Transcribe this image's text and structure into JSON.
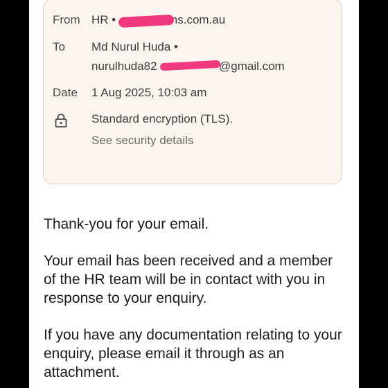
{
  "header": {
    "from_label": "From",
    "from_value": "HR • ",
    "from_domain": "ins.com.au",
    "to_label": "To",
    "to_name": "Md Nurul Huda •",
    "to_email_prefix": "nurulhuda82",
    "to_email_suffix": "@gmail.com",
    "date_label": "Date",
    "date_value": "1 Aug 2025, 10:03 am",
    "encryption_text": "Standard encryption (TLS).",
    "security_link": "See security details",
    "lock_icon": "lock-icon",
    "redaction_color": "#f02e78"
  },
  "message": {
    "para1": "Thank-you for your email.",
    "para2": "Your email has been received and a member of the HR team will be in contact with you in response to your enquiry.",
    "para3": "If you have any documentation relating to your enquiry, please email it through as an attachment."
  }
}
